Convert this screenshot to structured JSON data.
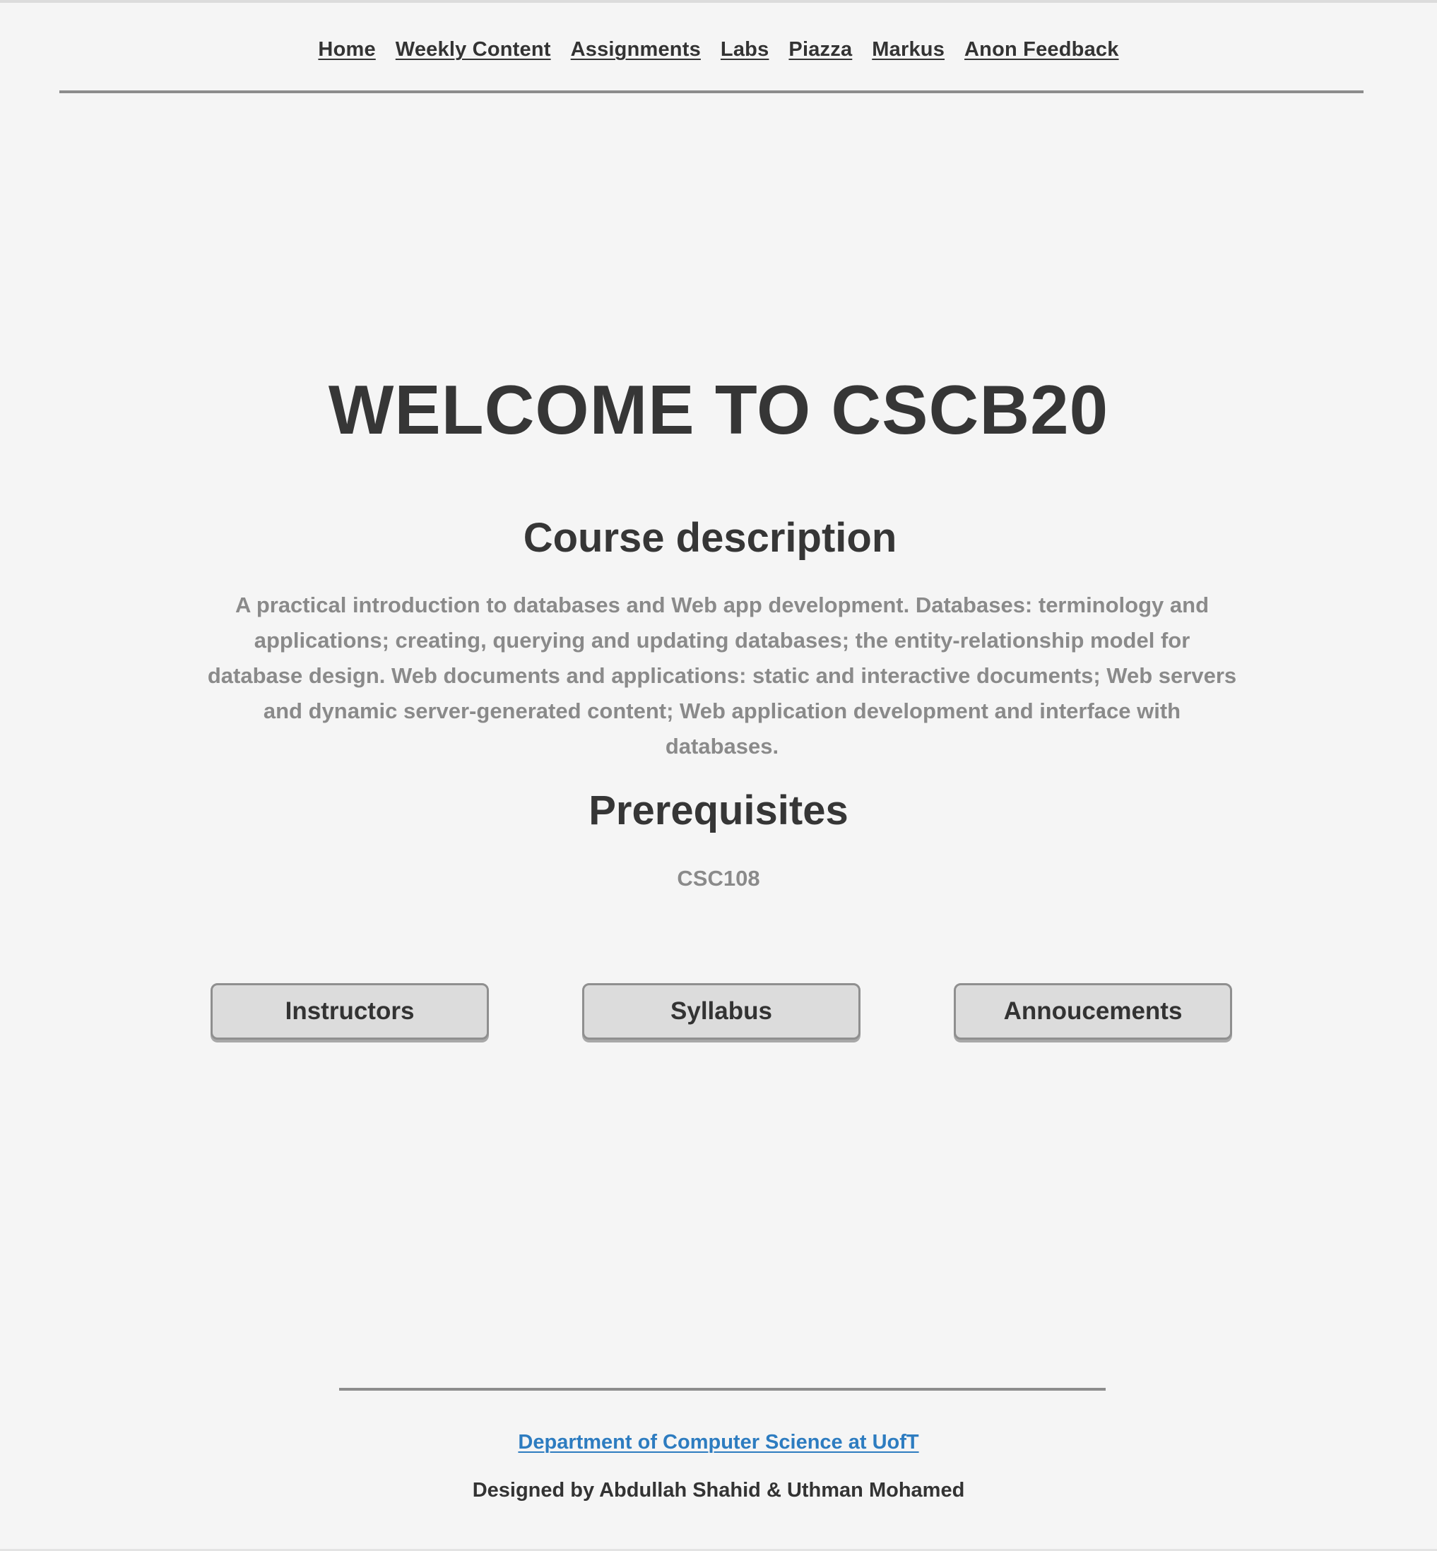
{
  "nav": {
    "items": [
      {
        "label": "Home"
      },
      {
        "label": "Weekly Content"
      },
      {
        "label": "Assignments"
      },
      {
        "label": "Labs"
      },
      {
        "label": "Piazza"
      },
      {
        "label": "Markus"
      },
      {
        "label": "Anon Feedback"
      }
    ]
  },
  "main": {
    "title": "WELCOME TO CSCB20",
    "course_heading": "Course description",
    "course_description": "A practical introduction to databases and Web app development. Databases: terminology and applications; creating, querying and updating databases; the entity-relationship model for database design. Web documents and applications: static and interactive documents; Web servers and dynamic server-generated content; Web application development and interface with databases.",
    "prereq_heading": "Prerequisites",
    "prereq_value": "CSC108"
  },
  "buttons": {
    "instructors": "Instructors",
    "syllabus": "Syllabus",
    "announcements": "Annoucements"
  },
  "footer": {
    "link_text": "Department of Computer Science at UofT",
    "credits": "Designed by Abdullah Shahid & Uthman Mohamed"
  },
  "colors": {
    "background": "#f5f5f5",
    "heading_text": "#363636",
    "muted_text": "#8a8a8a",
    "link_blue": "#2d7cc0",
    "button_bg": "#dcdcdc"
  }
}
